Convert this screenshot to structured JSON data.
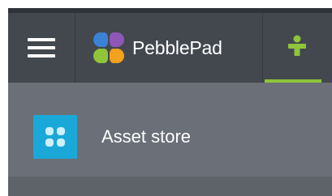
{
  "header": {
    "brand_name": "PebblePad",
    "menu_icon": "hamburger-menu-icon",
    "brand_logo_icon": "pebblepad-logo-icon",
    "active_tab_icon": "person-pin-icon"
  },
  "section": {
    "icon": "asset-store-grid-icon",
    "title": "Asset store"
  },
  "colors": {
    "header_bg": "#43484f",
    "section_bg": "#6b7078",
    "accent_green": "#8fc43b",
    "tile_blue": "#1aa8d8",
    "logo_blue": "#3b82d6",
    "logo_purple": "#8e57b8",
    "logo_green": "#8fc43b",
    "logo_orange": "#f4a11d"
  }
}
